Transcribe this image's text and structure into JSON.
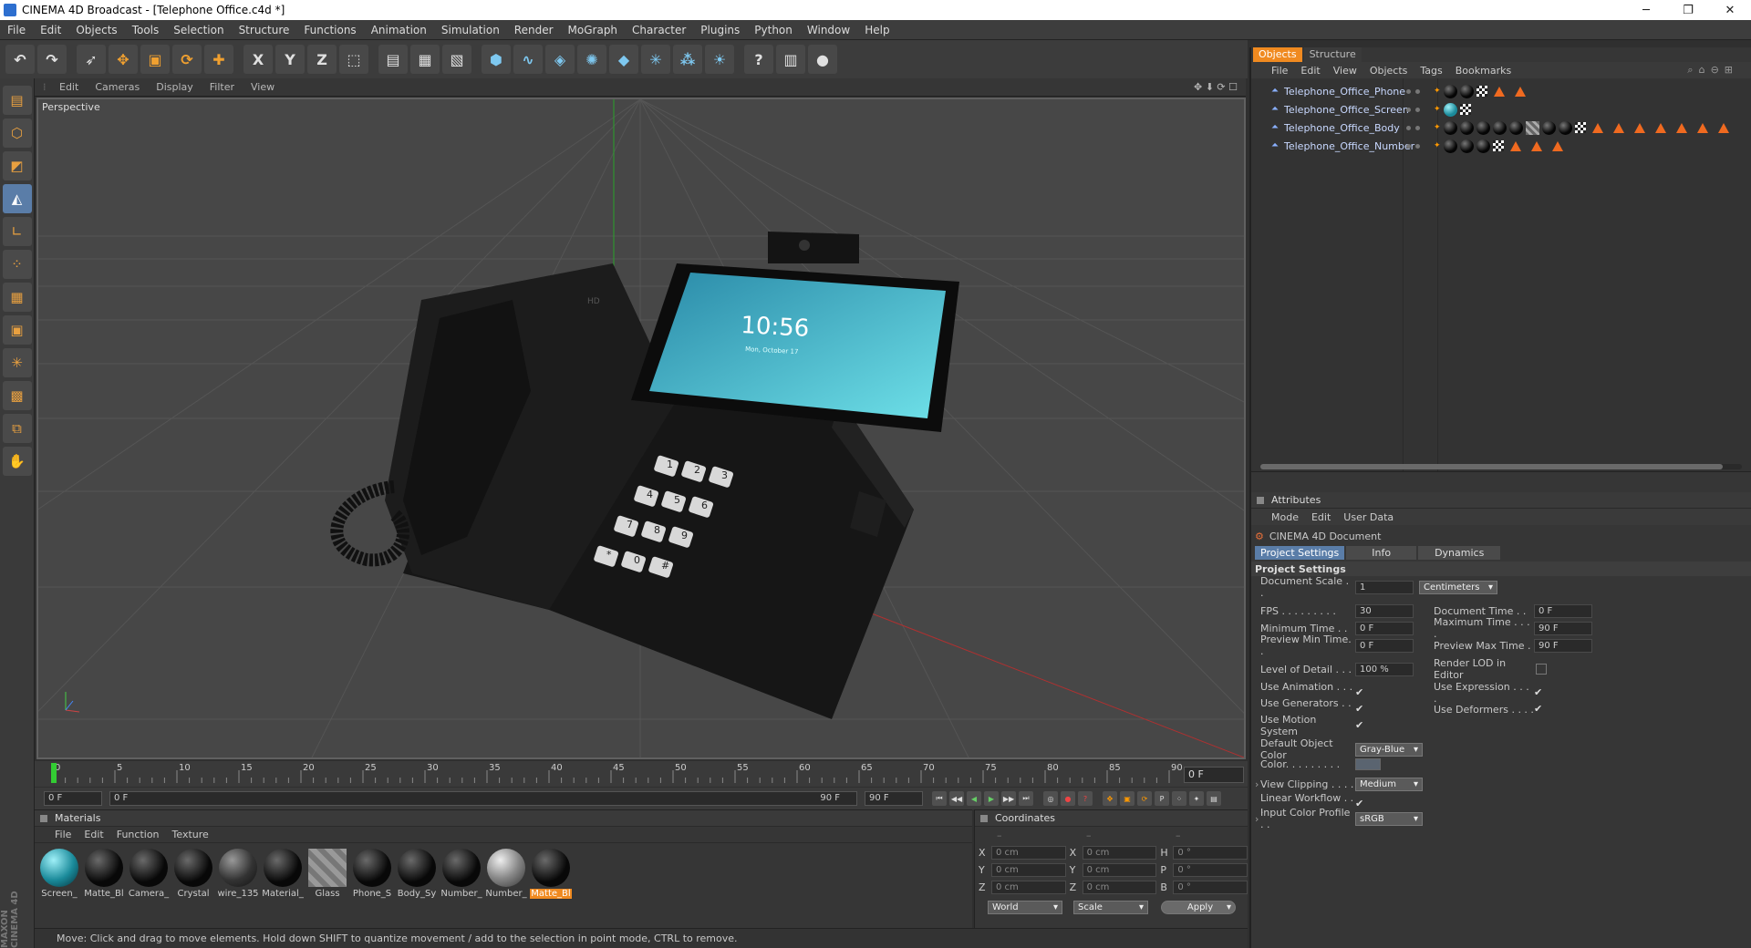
{
  "window": {
    "title": "CINEMA 4D Broadcast - [Telephone Office.c4d *]",
    "minimize": "─",
    "maximize": "❐",
    "close": "✕"
  },
  "menu": [
    "File",
    "Edit",
    "Objects",
    "Tools",
    "Selection",
    "Structure",
    "Functions",
    "Animation",
    "Simulation",
    "Render",
    "MoGraph",
    "Character",
    "Plugins",
    "Python",
    "Window",
    "Help"
  ],
  "toolbar_icons": [
    "undo-icon",
    "redo-icon",
    "select-icon",
    "move-icon",
    "scale-icon",
    "rotate-icon",
    "add-icon",
    "x-axis-icon",
    "y-axis-icon",
    "z-axis-icon",
    "coordinate-system-icon",
    "render-view-icon",
    "render-picture-queue-icon",
    "render-settings-icon",
    "cube-icon",
    "spline-icon",
    "nurbs-icon",
    "array-icon",
    "deformer-icon",
    "scene-icon",
    "camera-icon",
    "light-icon",
    "help-icon",
    "layout-icon",
    "record-icon"
  ],
  "toolbar_glyphs": [
    "↶",
    "↷",
    "➶",
    "✥",
    "▣",
    "⟳",
    "✚",
    "X",
    "Y",
    "Z",
    "⬚",
    "▤",
    "▦",
    "▧",
    "⬢",
    "∿",
    "◈",
    "✺",
    "◆",
    "✳",
    "⁂",
    "☀",
    "?",
    "▥",
    "●"
  ],
  "viewport": {
    "menu": [
      "Edit",
      "Cameras",
      "Display",
      "Filter",
      "View"
    ],
    "label": "Perspective",
    "nav_icons": "✥ ⬇ ⟳ ☐"
  },
  "phone": {
    "clock": "10:56",
    "date": "Mon, October 17",
    "brand": "HD",
    "keys": [
      "1",
      "2",
      "3",
      "4",
      "5",
      "6",
      "7",
      "8",
      "9",
      "*",
      "0",
      "#"
    ]
  },
  "timeline": {
    "ticks": [
      "0",
      "5",
      "10",
      "15",
      "20",
      "25",
      "30",
      "35",
      "40",
      "45",
      "50",
      "55",
      "60",
      "65",
      "70",
      "75",
      "80",
      "85",
      "90"
    ],
    "current_frame": "0 F"
  },
  "transport": {
    "start": "0 F",
    "range_start": "0 F",
    "range_end": "90 F",
    "end": "90 F"
  },
  "materials": {
    "title": "Materials",
    "menu": [
      "File",
      "Edit",
      "Function",
      "Texture"
    ],
    "items": [
      {
        "name": "Screen_",
        "style": "teal"
      },
      {
        "name": "Matte_Bl",
        "style": "black"
      },
      {
        "name": "Camera_",
        "style": "black"
      },
      {
        "name": "Crystal",
        "style": "black"
      },
      {
        "name": "wire_135",
        "style": "mid"
      },
      {
        "name": "Material_",
        "style": "black"
      },
      {
        "name": "Glass",
        "style": "glass"
      },
      {
        "name": "Phone_S",
        "style": "black"
      },
      {
        "name": "Body_Sy",
        "style": "black"
      },
      {
        "name": "Number_",
        "style": "black"
      },
      {
        "name": "Number_",
        "style": "grey"
      },
      {
        "name": "Matte_Bl",
        "style": "black",
        "selected": true
      }
    ]
  },
  "coordinates": {
    "title": "Coordinates",
    "head": [
      "–",
      "–",
      "–"
    ],
    "rows": [
      {
        "a": "X",
        "v1": "0 cm",
        "b": "X",
        "v2": "0 cm",
        "c": "H",
        "v3": "0 °"
      },
      {
        "a": "Y",
        "v1": "0 cm",
        "b": "Y",
        "v2": "0 cm",
        "c": "P",
        "v3": "0 °"
      },
      {
        "a": "Z",
        "v1": "0 cm",
        "b": "Z",
        "v2": "0 cm",
        "c": "B",
        "v3": "0 °"
      }
    ],
    "world": "World",
    "scale": "Scale",
    "apply": "Apply"
  },
  "status": "Move: Click and drag to move elements. Hold down SHIFT to quantize movement / add to the selection in point mode, CTRL to remove.",
  "brand": "MAXON CINEMA 4D",
  "objects": {
    "tabs": [
      "Objects",
      "Structure"
    ],
    "menu": [
      "File",
      "Edit",
      "View",
      "Objects",
      "Tags",
      "Bookmarks"
    ],
    "items": [
      {
        "name": "Telephone_Office_Phone",
        "tags": [
          "ball",
          "ball",
          "chk",
          "tri",
          "tri"
        ]
      },
      {
        "name": "Telephone_Office_Screen",
        "tags": [
          "teal",
          "chk"
        ]
      },
      {
        "name": "Telephone_Office_Body",
        "tags": [
          "ball",
          "ball",
          "ball",
          "ball",
          "ball",
          "stripe",
          "ball",
          "ball",
          "chk",
          "tri",
          "tri",
          "tri",
          "tri",
          "tri",
          "tri",
          "tri"
        ]
      },
      {
        "name": "Telephone_Office_Number",
        "tags": [
          "ball",
          "ball",
          "ball",
          "chk",
          "tri",
          "tri",
          "tri"
        ]
      }
    ]
  },
  "attributes": {
    "title": "Attributes",
    "menu": [
      "Mode",
      "Edit",
      "User Data"
    ],
    "doc": "CINEMA 4D Document",
    "tabs": [
      "Project Settings",
      "Info",
      "Dynamics"
    ],
    "section": "Project Settings",
    "document_scale_label": "Document Scale . .",
    "document_scale": "1",
    "units": "Centimeters",
    "fps_label": "FPS . . . . . . . . .",
    "fps": "30",
    "doc_time_label": "Document Time . .",
    "doc_time": "0 F",
    "min_time_label": "Minimum Time . .",
    "min_time": "0 F",
    "max_time_label": "Maximum Time . . . .",
    "max_time": "90 F",
    "prev_min_label": "Preview Min Time. .",
    "prev_min": "0 F",
    "prev_max_label": "Preview Max Time .",
    "prev_max": "90 F",
    "lod_label": "Level of Detail . . .",
    "lod": "100 %",
    "render_lod_label": "Render LOD in Editor",
    "use_anim_label": "Use Animation . . . .",
    "use_expr_label": "Use Expression . . . .",
    "use_gen_label": "Use Generators . . .",
    "use_deform_label": "Use Deformers . . . .",
    "use_motion_label": "Use Motion System",
    "def_color_label": "Default Object Color",
    "def_color": "Gray-Blue",
    "color_label": "Color. . . . . . . . .",
    "view_clip_label": "View Clipping . . . .",
    "view_clip": "Medium",
    "linear_label": "Linear Workflow . . .",
    "icc_label": "Input Color Profile . .",
    "icc": "sRGB",
    "check": "✔"
  },
  "colors": {
    "accent": "#f08a20",
    "selection": "#5a7da8",
    "background": "#363636"
  }
}
